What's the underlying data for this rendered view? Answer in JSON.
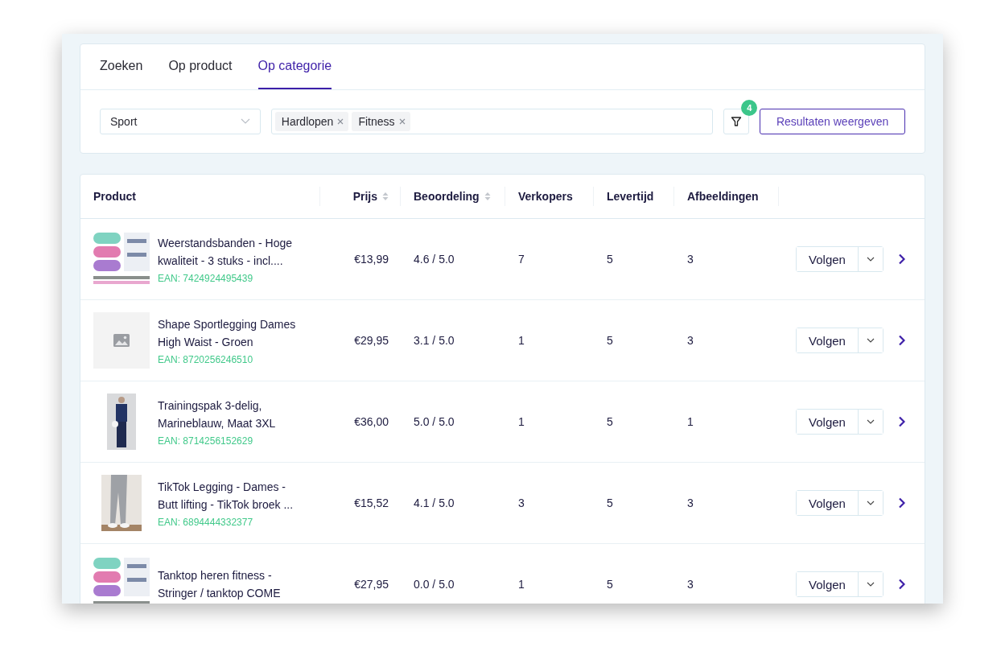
{
  "tabs": [
    {
      "label": "Zoeken",
      "selected": false
    },
    {
      "label": "Op product",
      "selected": false
    },
    {
      "label": "Op categorie",
      "selected": true
    }
  ],
  "filters": {
    "category": "Sport",
    "tags": [
      "Hardlopen",
      "Fitness"
    ],
    "filter_count": "4",
    "submit": "Resultaten weergeven"
  },
  "table": {
    "columns": [
      {
        "label": "Product",
        "sortable": false
      },
      {
        "label": "Prijs",
        "sortable": true
      },
      {
        "label": "Beoordeling",
        "sortable": true
      },
      {
        "label": "Verkopers",
        "sortable": false
      },
      {
        "label": "Levertijd",
        "sortable": false
      },
      {
        "label": "Afbeeldingen",
        "sortable": false
      }
    ],
    "rows": [
      {
        "title": "Weerstandsbanden - Hoge kwaliteit - 3 stuks - incl....",
        "ean": "EAN: 7424924495439",
        "price": "€13,99",
        "rating": "4.6 / 5.0",
        "sellers": "7",
        "delivery": "5",
        "images": "3",
        "follow": "Volgen"
      },
      {
        "image": {
          "kind": "placeholder"
        },
        "title": "Shape Sportlegging Dames High Waist - Groen",
        "ean": "EAN: 8720256246510",
        "price": "€29,95",
        "rating": "3.1 / 5.0",
        "sellers": "1",
        "delivery": "5",
        "images": "3",
        "follow": "Volgen"
      },
      {
        "title": "Trainingspak 3-delig, Marineblauw, Maat 3XL",
        "ean": "EAN: 8714256152629",
        "price": "€36,00",
        "rating": "5.0 / 5.0",
        "sellers": "1",
        "delivery": "5",
        "images": "1",
        "follow": "Volgen"
      },
      {
        "title": "TikTok Legging - Dames - Butt lifting - TikTok broek ...",
        "ean": "EAN: 6894444332377",
        "price": "€15,52",
        "rating": "4.1 / 5.0",
        "sellers": "3",
        "delivery": "5",
        "images": "3",
        "follow": "Volgen"
      },
      {
        "title": "Tanktop heren fitness - Stringer / tanktop COME",
        "price": "€27,95",
        "rating": "0.0 / 5.0",
        "sellers": "1",
        "delivery": "5",
        "images": "3",
        "follow": "Volgen"
      }
    ]
  }
}
